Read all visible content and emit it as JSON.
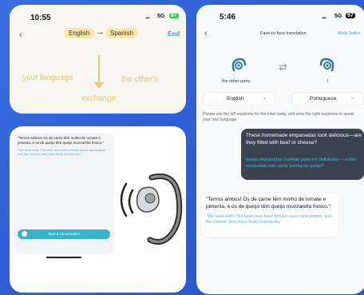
{
  "colors": {
    "background": "#2f5fd6",
    "accent_teal": "#37b2c8",
    "accent_blue": "#3ca0d8",
    "label_gold": "#e6c76a",
    "dark_bubble": "#3b4250"
  },
  "panel1": {
    "status": {
      "time": "10:55",
      "bars": "....",
      "network": "5G",
      "battery": "87"
    },
    "nav": {
      "back_icon": "chevron-left-icon",
      "from_lang": "English",
      "arrow": "→",
      "to_lang": "Spanish",
      "end_label": "End"
    },
    "labels": {
      "your_language": "your language",
      "the_others": "the other's",
      "exchange": "exchange"
    }
  },
  "panel2": {
    "pt_text": "\"Temos ambos! Os de carne têm molho de tomate e pimenta, e os de queijo têm queijo mozzarella fresco.\"",
    "en_text": "\"We have both! The beef ones have tomato sauce and pepper, and the cheese ones have fresh mozzarella.\"",
    "start_button": "Start a conversation",
    "earbud_icon": "earbud-icon"
  },
  "panel3": {
    "status": {
      "time": "5:46",
      "bars": "....",
      "network": "5G",
      "battery": "97"
    },
    "title": "Face-to-face translation",
    "mode_switch": "Mode Switch",
    "left_party_label": "the other party",
    "right_party_label": "I",
    "swap_icon": "swap-icon",
    "left_language": "English",
    "right_language": "Portuguese",
    "hint": "Please use the left earphone for the other party, and wear the right earphone to speak your own language.",
    "dark_bubble": {
      "en": "These homemade empanadas look delicious—are they filled with beef or cheese?",
      "pt": "Essas empanadas caseiras parecem deliciosas — estão recheadas com carne bovina ou queijo?"
    },
    "light_bubble": {
      "pt": "\"Temos ambos! Os de carne têm molho de tomate e pimenta, e os de queijo têm queijo mozzarella fresco.\"",
      "en": "\"We have both! The beef ones have tomato sauce and pepper, and the cheese ones have fresh mozzarella.\""
    }
  }
}
